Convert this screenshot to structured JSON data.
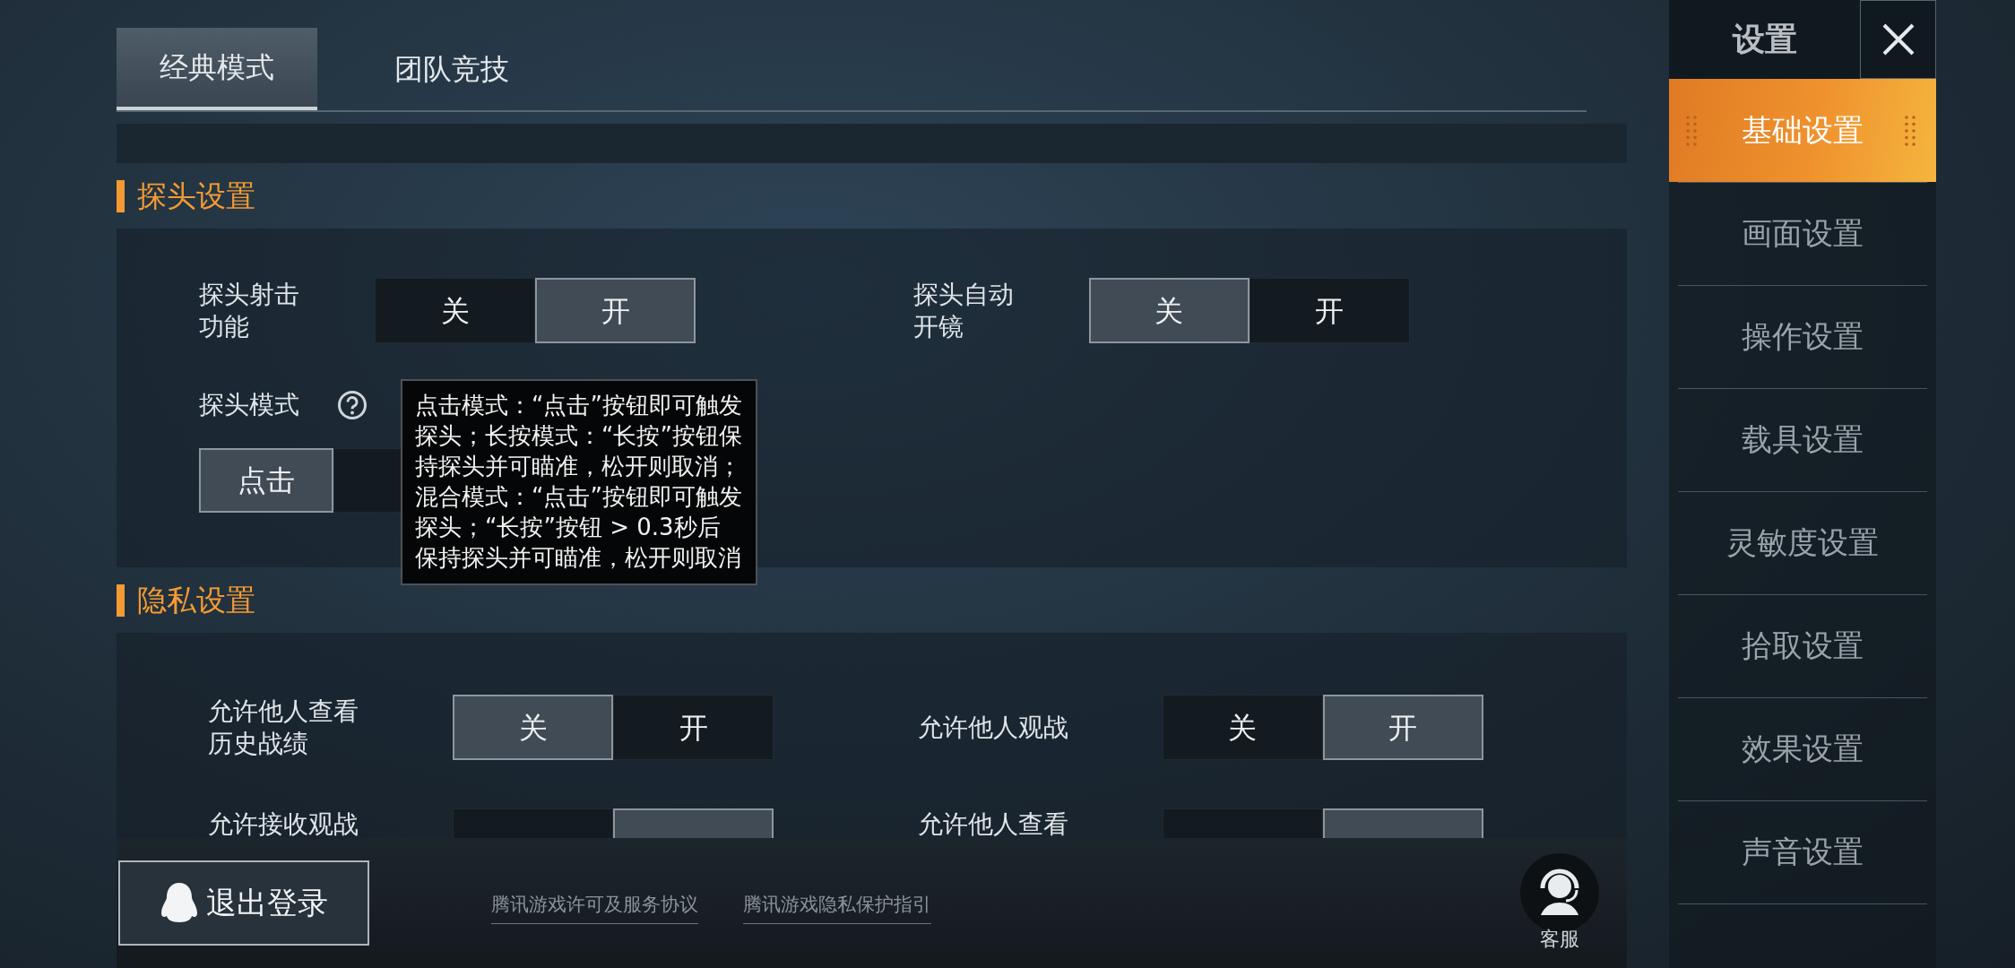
{
  "tabs": [
    {
      "label": "经典模式",
      "selected": true
    },
    {
      "label": "团队竞技",
      "selected": false
    }
  ],
  "sections": [
    {
      "title": "探头设置",
      "rows": [
        [
          {
            "kind": "toggle",
            "label": "探头射击功能",
            "options": [
              {
                "label": "关",
                "selected": false
              },
              {
                "label": "开",
                "selected": true
              }
            ]
          },
          {
            "kind": "toggle",
            "label": "探头自动开镜",
            "options": [
              {
                "label": "关",
                "selected": true
              },
              {
                "label": "开",
                "selected": false
              }
            ]
          }
        ],
        [
          {
            "kind": "mode",
            "label": "探头模式",
            "options": [
              {
                "label": "点击",
                "selected": true
              },
              {
                "selected": false
              }
            ]
          }
        ]
      ]
    },
    {
      "title": "隐私设置",
      "rows": [
        [
          {
            "kind": "toggle",
            "label": "允许他人查看历史战绩",
            "options": [
              {
                "label": "关",
                "selected": true
              },
              {
                "label": "开",
                "selected": false
              }
            ]
          },
          {
            "kind": "toggle",
            "label": "允许他人观战",
            "options": [
              {
                "label": "关",
                "selected": false
              },
              {
                "label": "开",
                "selected": true
              }
            ]
          }
        ],
        [
          {
            "kind": "toggle",
            "label": "允许接收观战",
            "options": [
              {
                "selected": false
              },
              {
                "selected": true
              }
            ]
          },
          {
            "kind": "toggle",
            "label": "允许他人查看",
            "options": [
              {
                "selected": false
              },
              {
                "selected": true
              }
            ]
          }
        ]
      ]
    }
  ],
  "tooltip": {
    "text": "点击模式：“点击”按钮即可触发探头；长按模式：“长按”按钮保持探头并可瞄准，松开则取消；混合模式：“点击”按钮即可触发探头；“长按”按钮 > 0.3秒后保持探头并可瞄准，松开则取消"
  },
  "footer": {
    "logout": "退出登录",
    "links": [
      "腾讯游戏许可及服务协议",
      "腾讯游戏隐私保护指引"
    ],
    "service": "客服"
  },
  "sidebar": {
    "title": "设置",
    "items": [
      {
        "label": "基础设置",
        "selected": true
      },
      {
        "label": "画面设置",
        "selected": false
      },
      {
        "label": "操作设置",
        "selected": false
      },
      {
        "label": "载具设置",
        "selected": false
      },
      {
        "label": "灵敏度设置",
        "selected": false
      },
      {
        "label": "拾取设置",
        "selected": false
      },
      {
        "label": "效果设置",
        "selected": false
      },
      {
        "label": "声音设置",
        "selected": false
      },
      {
        "selected": false
      }
    ]
  }
}
